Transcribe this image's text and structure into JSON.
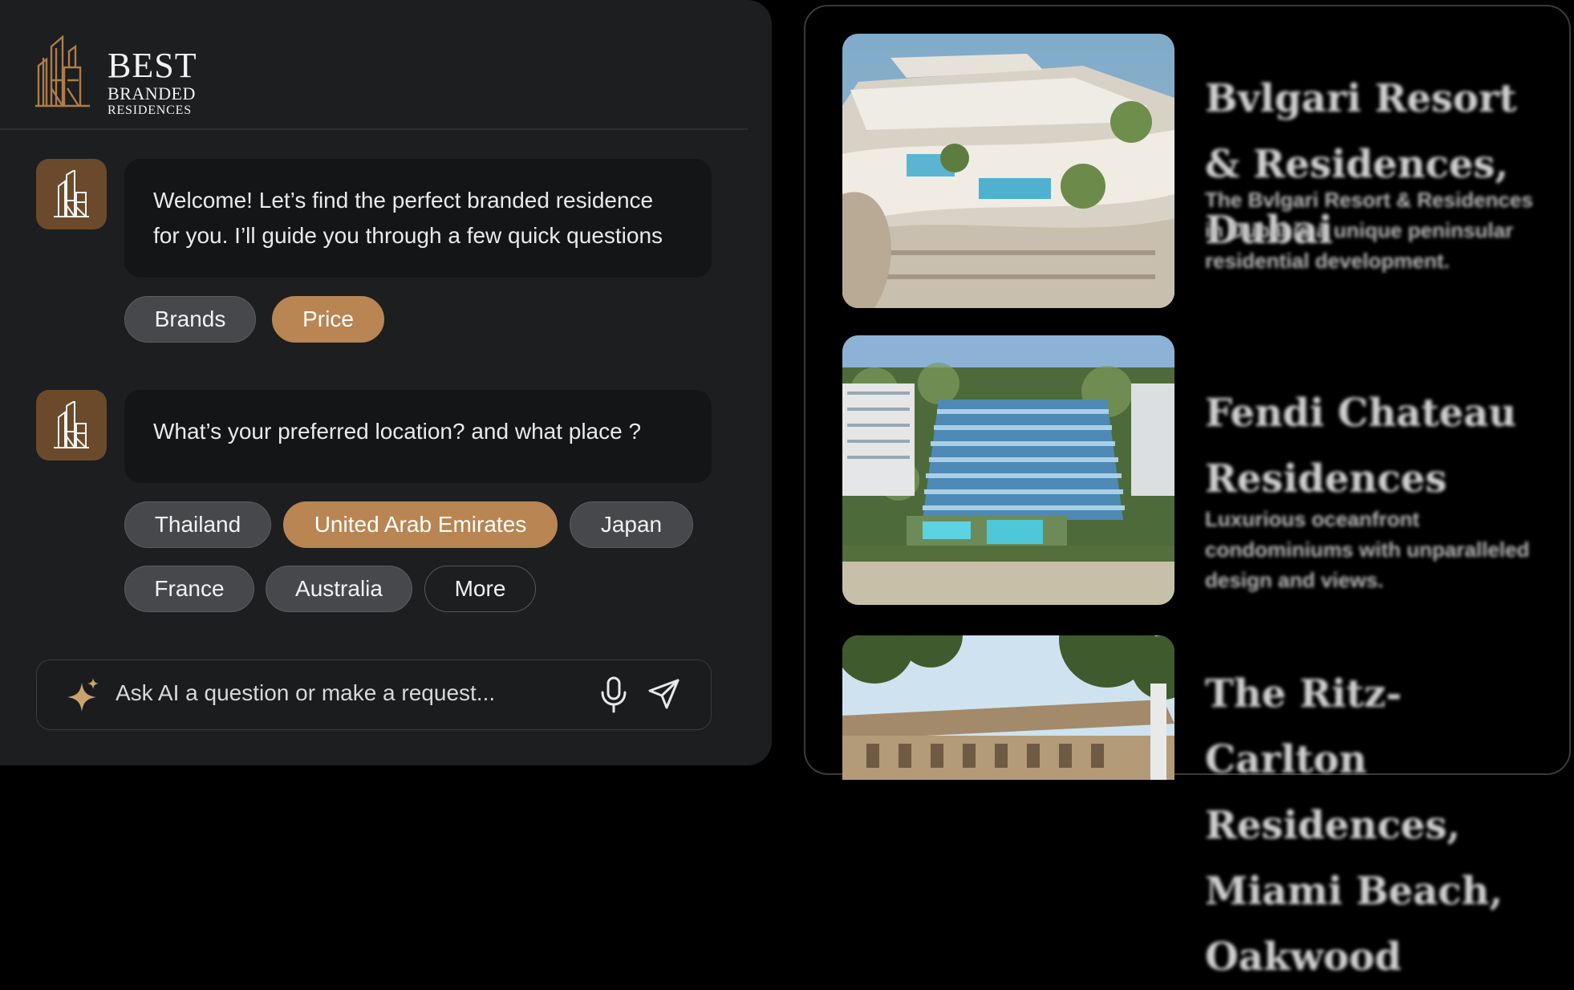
{
  "brand": {
    "line1": "BEST",
    "line2": "BRANDED",
    "line3": "RESIDENCES"
  },
  "messages": [
    {
      "text": "Welcome! Let’s find the perfect branded residence for you. I’ll guide you through a few quick questions",
      "options": [
        {
          "label": "Brands",
          "selected": false
        },
        {
          "label": "Price",
          "selected": true
        }
      ]
    },
    {
      "text": "What’s your preferred location? and what place ?",
      "options": [
        {
          "label": "Thailand",
          "selected": false
        },
        {
          "label": "United Arab Emirates",
          "selected": true
        },
        {
          "label": "Japan",
          "selected": false
        },
        {
          "label": "France",
          "selected": false
        },
        {
          "label": "Australia",
          "selected": false
        },
        {
          "label": "More",
          "selected": false
        }
      ]
    }
  ],
  "input": {
    "placeholder": "Ask AI a question or make a request..."
  },
  "icons": {
    "sparkle": "sparkle-icon",
    "mic": "microphone-icon",
    "send": "send-icon",
    "avatar": "brand-logo-icon"
  },
  "colors": {
    "accent": "#b98552",
    "panel": "#1c1e20",
    "bubble": "#131517",
    "chip": "#46484b"
  },
  "listings": [
    {
      "title": "Bvlgari Resort & Residences, Dubai",
      "description": "The Bvlgari Resort & Residences in Dubai is a unique peninsular residential development."
    },
    {
      "title": "Fendi Chateau Residences",
      "description": "Luxurious oceanfront condominiums with unparalleled design and views."
    },
    {
      "title": "The Ritz-Carlton Residences, Miami Beach, Oakwood",
      "description": ""
    }
  ]
}
